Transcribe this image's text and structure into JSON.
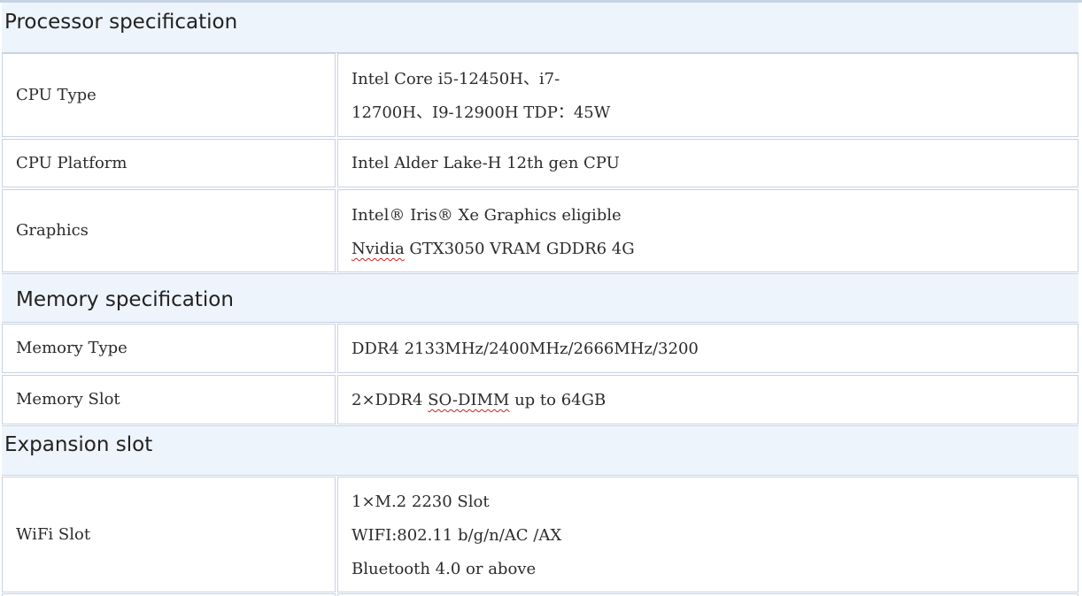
{
  "sections": {
    "processor": {
      "title": "Processor specification",
      "rows": {
        "cpu_type": {
          "label": "CPU Type",
          "value_lines": [
            "Intel Core i5-12450H、i7-",
            "12700H、I9-12900H TDP：45W"
          ]
        },
        "cpu_platform": {
          "label": "CPU Platform",
          "value": "Intel Alder Lake-H 12th gen CPU"
        },
        "graphics": {
          "label": "Graphics",
          "line1": "Intel® Iris® Xe Graphics eligible",
          "line2_part1": "Nvidia",
          "line2_part2": " GTX3050 VRAM GDDR6 4G"
        }
      }
    },
    "memory": {
      "title": "Memory specification",
      "rows": {
        "memory_type": {
          "label": "Memory Type",
          "value": "DDR4 2133MHz/2400MHz/2666MHz/3200"
        },
        "memory_slot": {
          "label": "Memory Slot",
          "value_part1": "2×DDR4 ",
          "value_part2": "SO-DIMM",
          "value_part3": " up to 64GB"
        }
      }
    },
    "expansion": {
      "title": "Expansion slot",
      "rows": {
        "wifi_slot": {
          "label": "WiFi Slot",
          "value_lines": [
            "1×M.2 2230 Slot",
            "WIFI:802.11 b/g/n/AC /AX",
            "Bluetooth 4.0 or above"
          ]
        }
      }
    }
  },
  "colors": {
    "border": "#c6d3e3",
    "section_background": "#eef4fb",
    "spellcheck_underline": "#d02020"
  }
}
